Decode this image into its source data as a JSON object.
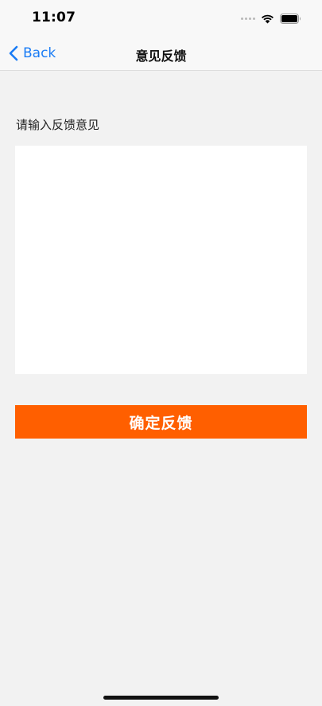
{
  "status_bar": {
    "time": "11:07",
    "icons": [
      "signal-dots-icon",
      "wifi-icon",
      "battery-icon"
    ]
  },
  "nav": {
    "back_label": "Back",
    "title": "意见反馈"
  },
  "form": {
    "label": "请输入反馈意见",
    "input_value": "",
    "submit_label": "确定反馈"
  },
  "colors": {
    "accent": "#ff5f00",
    "link": "#1a7cf5",
    "background": "#f2f2f2"
  }
}
